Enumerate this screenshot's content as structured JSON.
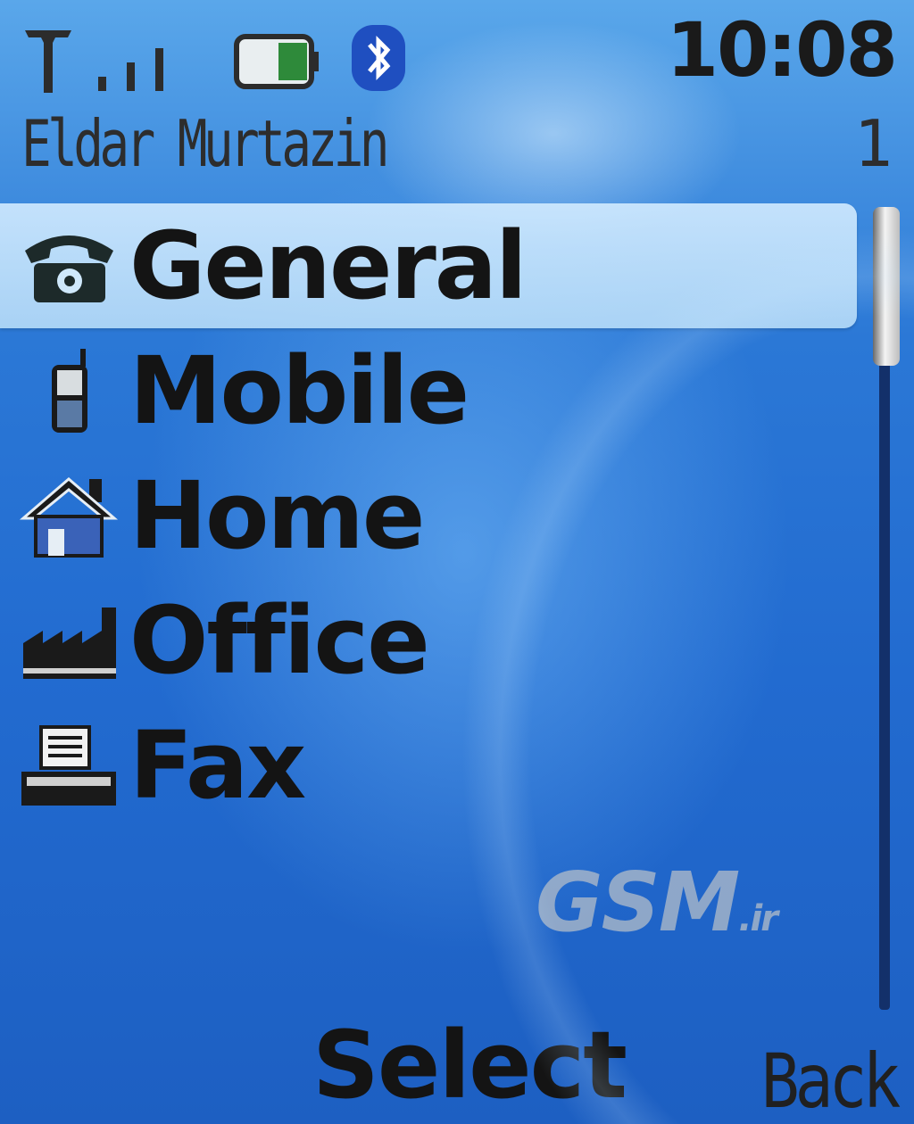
{
  "status_bar": {
    "time": "10:08",
    "signal_icon": "antenna-signal-icon",
    "battery_icon": "battery-icon",
    "bluetooth_icon": "bluetooth-icon"
  },
  "header": {
    "contact_name": "Eldar Murtazin",
    "entry_index": "1"
  },
  "number_types": [
    {
      "label": "General",
      "icon": "telephone-icon",
      "selected": true
    },
    {
      "label": "Mobile",
      "icon": "mobile-phone-icon",
      "selected": false
    },
    {
      "label": "Home",
      "icon": "house-icon",
      "selected": false
    },
    {
      "label": "Office",
      "icon": "factory-icon",
      "selected": false
    },
    {
      "label": "Fax",
      "icon": "fax-icon",
      "selected": false
    }
  ],
  "watermark": {
    "main": "GSM",
    "suffix": ".ir"
  },
  "softkeys": {
    "middle": "Select",
    "right": "Back"
  },
  "colors": {
    "background": "#2a6fcb",
    "highlight": "#cfe8fb",
    "text": "#141414"
  }
}
